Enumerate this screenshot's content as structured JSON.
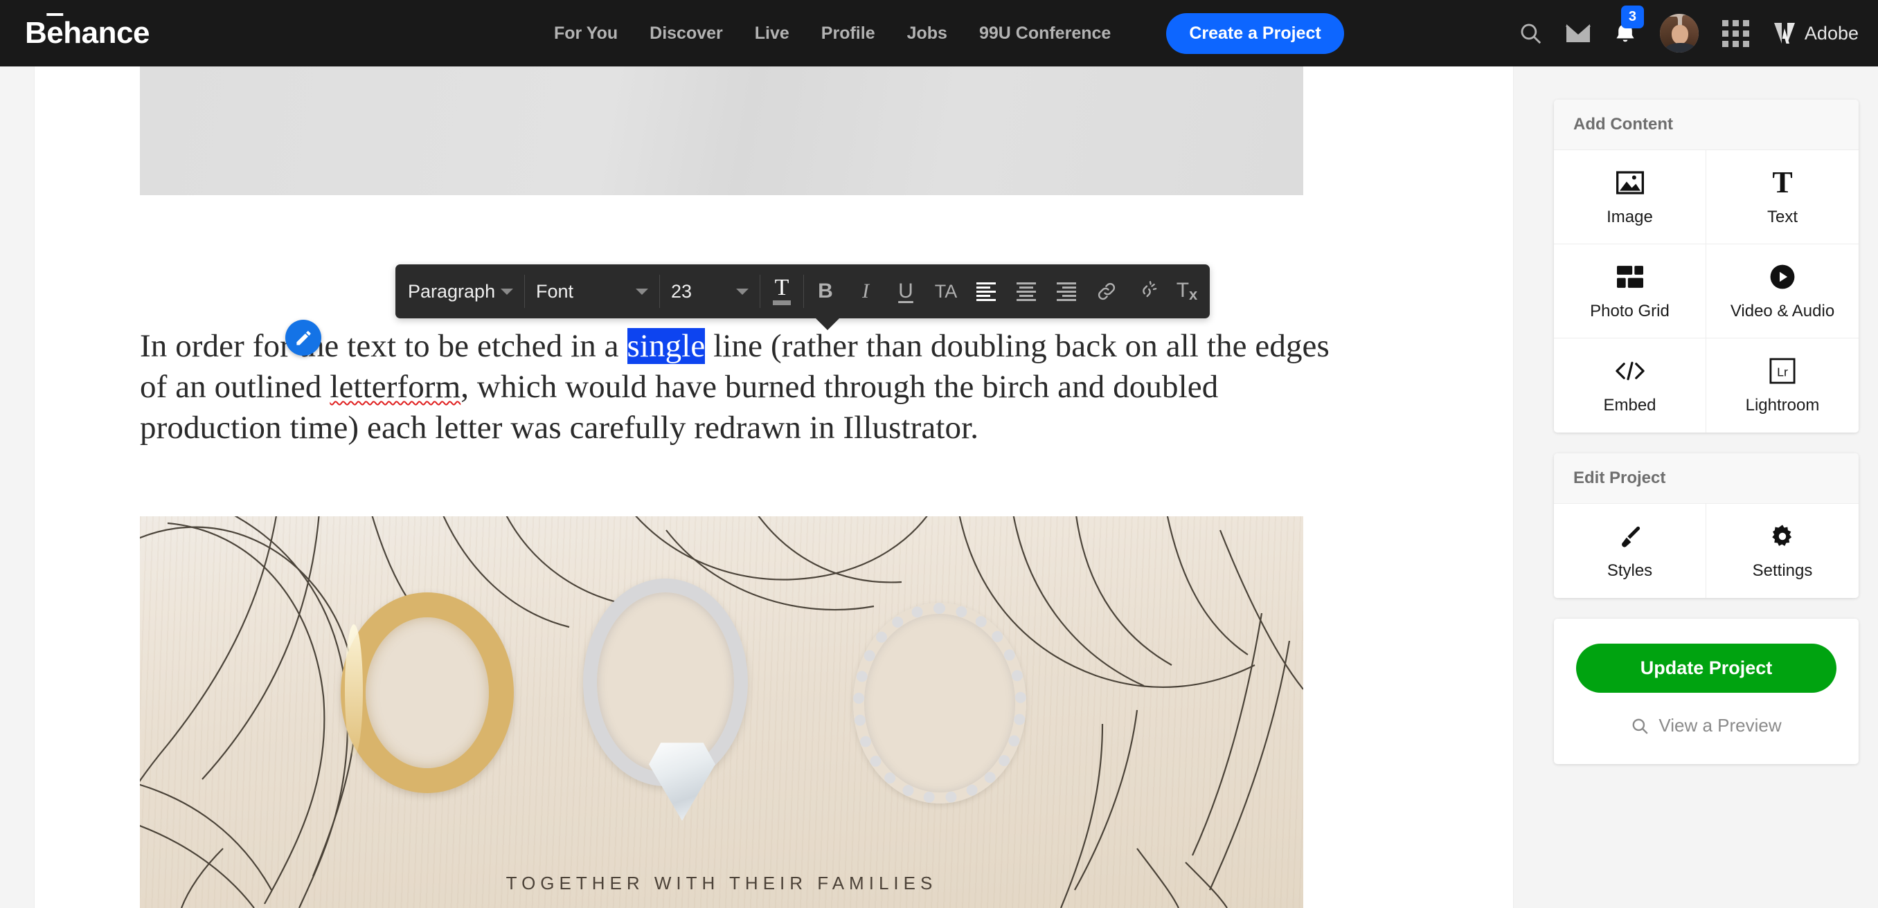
{
  "header": {
    "brand": "Behance",
    "nav": [
      {
        "label": "For You"
      },
      {
        "label": "Discover"
      },
      {
        "label": "Live"
      },
      {
        "label": "Profile"
      },
      {
        "label": "Jobs"
      },
      {
        "label": "99U Conference"
      }
    ],
    "create_button": "Create a Project",
    "icons": {
      "search": "search-icon",
      "mail": "mail-icon",
      "bell": "bell-icon",
      "apps": "app-grid-icon",
      "avatar": "user-avatar"
    },
    "notification_count": "3",
    "adobe_label": "Adobe",
    "accent_blue": "#0d66ff",
    "background": "#191919"
  },
  "editor_toolbar": {
    "paragraph_style": "Paragraph",
    "font": "Font",
    "font_size": "23",
    "buttons": [
      {
        "name": "text-color-button",
        "label": "T",
        "active": true
      },
      {
        "name": "bold-button",
        "label": "B",
        "active": false
      },
      {
        "name": "italic-button",
        "label": "I",
        "active": false
      },
      {
        "name": "underline-button",
        "label": "U",
        "active": false
      },
      {
        "name": "letter-spacing-button",
        "label": "TA",
        "active": false
      },
      {
        "name": "align-left-button",
        "label": "",
        "active": true
      },
      {
        "name": "align-center-button",
        "label": "",
        "active": false
      },
      {
        "name": "align-right-button",
        "label": "",
        "active": false
      },
      {
        "name": "link-button",
        "label": "",
        "active": false
      },
      {
        "name": "unlink-button",
        "label": "",
        "active": false
      },
      {
        "name": "clear-formatting-button",
        "label": "Tx",
        "active": false
      }
    ]
  },
  "content": {
    "paragraph": {
      "before_selection": "In order for the text to be etched in a ",
      "selection": "single",
      "after_selection_1": " line (rather than doubling back on all the edges of an outlined ",
      "misspelled_word": "letterform",
      "after_selection_2": ", which would have burned through the birch and doubled production time) each letter was carefully redrawn in Illustrator.",
      "selection_color": "#0d44f0"
    },
    "photo_caption_engraved": "TOGETHER WITH THEIR FAMILIES",
    "edit_fab": "pencil-icon"
  },
  "sidebar": {
    "add_content": {
      "title": "Add Content",
      "tiles": [
        {
          "label": "Image",
          "icon": "image-icon"
        },
        {
          "label": "Text",
          "icon": "text-icon"
        },
        {
          "label": "Photo Grid",
          "icon": "photo-grid-icon"
        },
        {
          "label": "Video & Audio",
          "icon": "play-circle-icon"
        },
        {
          "label": "Embed",
          "icon": "code-icon"
        },
        {
          "label": "Lightroom",
          "icon": "lightroom-icon"
        }
      ]
    },
    "edit_project": {
      "title": "Edit Project",
      "tiles": [
        {
          "label": "Styles",
          "icon": "paintbrush-icon"
        },
        {
          "label": "Settings",
          "icon": "gear-icon"
        }
      ]
    },
    "actions": {
      "update_label": "Update Project",
      "update_color": "#00a310",
      "preview_label": "View a Preview",
      "preview_icon": "search-icon"
    }
  }
}
